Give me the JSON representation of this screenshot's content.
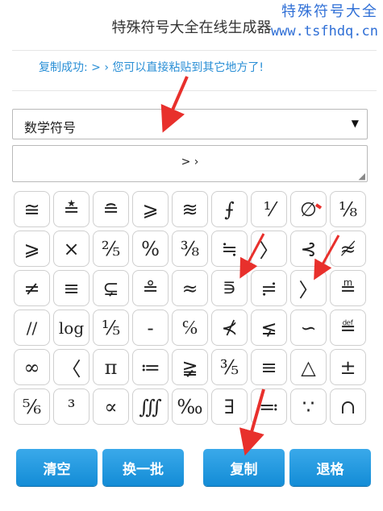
{
  "header": {
    "title": "特殊符号大全在线生成器",
    "watermark_cn": "特殊符号大全",
    "watermark_url": "www.tsfhdq.cn"
  },
  "status_message": "复制成功: > ›  您可以直接粘贴到其它地方了!",
  "category_select": {
    "value": "数学符号"
  },
  "output_box": {
    "value": "> ›"
  },
  "symbols": [
    "≅",
    "≛",
    "≘",
    "⩾",
    "≋",
    "⨍",
    "⅟",
    "∅",
    "⅛",
    "⩾",
    "×",
    "⅖",
    "%",
    "⅜",
    "≒",
    "〉",
    "⊰",
    "≉",
    "≠",
    "≡",
    "⊊",
    "≗",
    "≈",
    "⋾",
    "≓",
    "〉",
    "≞",
    "//",
    "log",
    "⅕",
    "-",
    "℅",
    "⊀",
    "⪇",
    "∽",
    "≝",
    "∞",
    "〈",
    "π",
    "≔",
    "≩",
    "⅗",
    "≡",
    "△",
    "±",
    "⅚",
    "³",
    "∝",
    "∭",
    "‰",
    "∃",
    "≕",
    "∵",
    "∩"
  ],
  "buttons": {
    "clear": "清空",
    "next_batch": "换一批",
    "copy": "复制",
    "backspace": "退格"
  },
  "colors": {
    "accent": "#138cd6",
    "status_text": "#2a8fd6",
    "watermark": "#2f6fd6",
    "annotation_arrow": "#e8302c"
  }
}
